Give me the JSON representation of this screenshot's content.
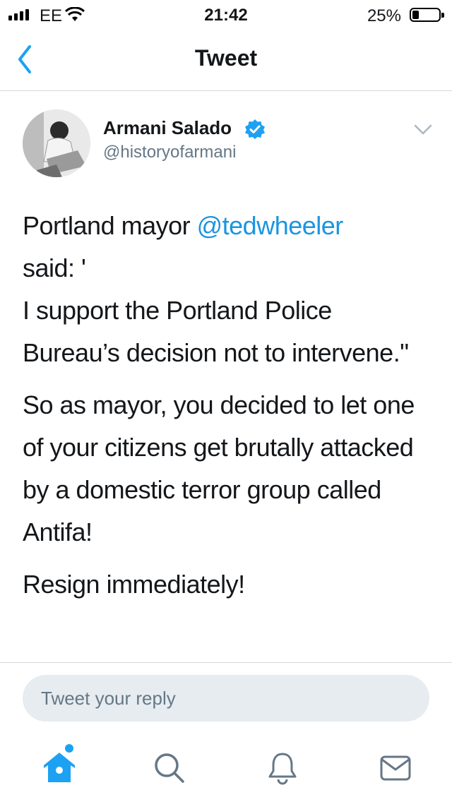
{
  "status_bar": {
    "carrier": "EE",
    "time": "21:42",
    "battery_percent": "25%",
    "battery_level": 0.25,
    "signal_bars": 4
  },
  "nav": {
    "title": "Tweet",
    "back_icon": "chevron-left-icon"
  },
  "tweet": {
    "author_name": "Armani Salado",
    "handle": "@historyofarmani",
    "verified": true,
    "paragraphs": [
      {
        "prefix": "Portland mayor ",
        "mention": "@tedwheeler",
        "said": "said: '",
        "rest": "I support the Portland Police Bureau’s decision not to intervene.\""
      },
      {
        "text": "So as mayor, you decided to let one of your citizens get brutally attacked by a domestic terror group called Antifa!"
      },
      {
        "text": "Resign immediately!"
      }
    ]
  },
  "reply": {
    "placeholder": "Tweet your reply"
  },
  "tab_bar": {
    "items": [
      "home-icon",
      "search-icon",
      "notifications-icon",
      "messages-icon"
    ],
    "active": "home-icon",
    "accent": "#1da1f2"
  },
  "colors": {
    "link": "#1b95e0",
    "accent": "#1da1f2",
    "secondary_text": "#657786",
    "reply_bg": "#e6ecf0"
  }
}
